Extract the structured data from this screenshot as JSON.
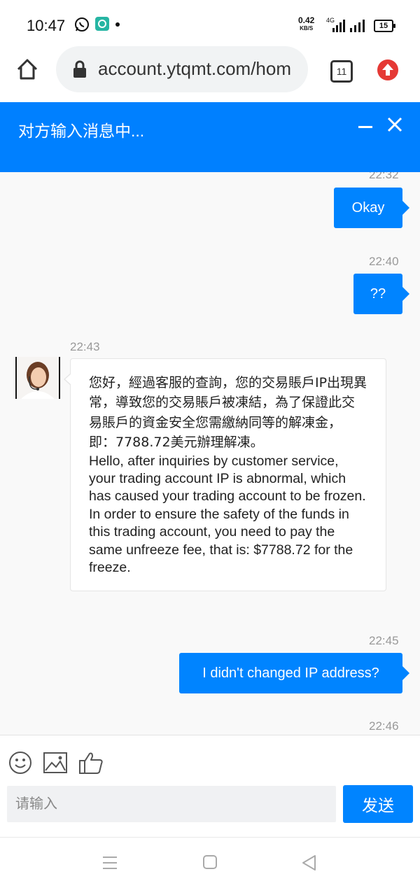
{
  "status_bar": {
    "time": "10:47",
    "speed_value": "0.42",
    "speed_unit": "KB/S",
    "network": "4G",
    "battery": "15"
  },
  "browser": {
    "url": "account.ytqmt.com/hom",
    "tab_count": "11"
  },
  "chat_header": {
    "title": "对方输入消息中..."
  },
  "messages": [
    {
      "time": "22:32",
      "text": "Okay"
    },
    {
      "time": "22:40",
      "text": "??"
    },
    {
      "time": "22:43",
      "text_zh": "您好，經過客服的查詢，您的交易賬戶IP出現異常，導致您的交易賬戶被凍結，為了保證此交易賬戶的資金安全您需繳納同等的解凍金，即：7788.72美元辦理解凍。",
      "text_en": "Hello, after inquiries by customer service, your trading account IP is abnormal, which has caused your trading account to be frozen. In order to ensure the safety of the funds in this trading account, you need to pay the same unfreeze fee, that is: $7788.72 for the freeze."
    },
    {
      "time": "22:45",
      "text": "I didn't changed IP address?"
    },
    {
      "time": "22:46"
    }
  ],
  "composer": {
    "placeholder": "请输入",
    "send_label": "发送"
  },
  "icons": {
    "home": "home-icon",
    "lock": "lock-icon",
    "upload": "upload-arrow-icon",
    "emoji": "emoji-icon",
    "image": "image-icon",
    "like": "thumbs-up-icon"
  },
  "colors": {
    "brand_blue": "#0080ff",
    "bubble_blue": "#0084ff"
  }
}
